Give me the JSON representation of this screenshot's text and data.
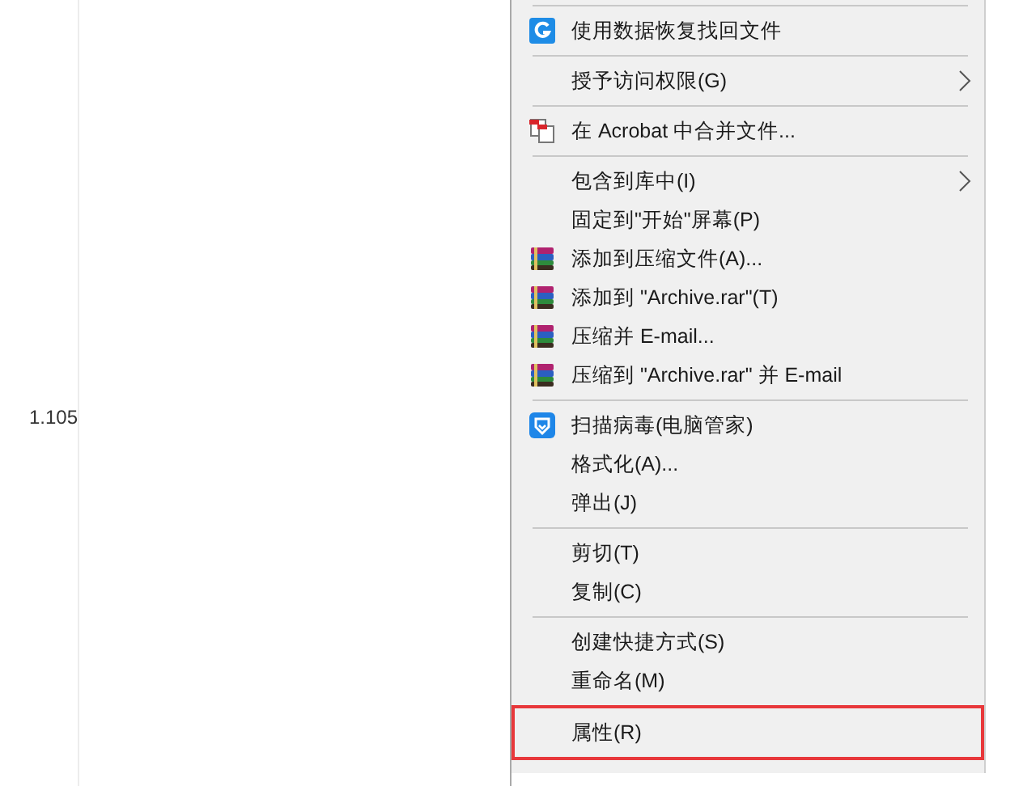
{
  "side_value": "1.105",
  "menu": {
    "groups": [
      [
        {
          "label": "使用数据恢复找回文件",
          "kind": "recovery",
          "submenu": false,
          "outlined": false
        }
      ],
      [
        {
          "label": "授予访问权限(G)",
          "kind": "plain",
          "submenu": true,
          "outlined": false
        }
      ],
      [
        {
          "label": "在 Acrobat 中合并文件...",
          "kind": "acrobat",
          "submenu": false,
          "outlined": false
        }
      ],
      [
        {
          "label": "包含到库中(I)",
          "kind": "plain",
          "submenu": true,
          "outlined": false
        },
        {
          "label": "固定到\"开始\"屏幕(P)",
          "kind": "plain",
          "submenu": false,
          "outlined": false
        },
        {
          "label": "添加到压缩文件(A)...",
          "kind": "archive",
          "submenu": false,
          "outlined": false
        },
        {
          "label": "添加到 \"Archive.rar\"(T)",
          "kind": "archive",
          "submenu": false,
          "outlined": false
        },
        {
          "label": "压缩并 E-mail...",
          "kind": "archive",
          "submenu": false,
          "outlined": false
        },
        {
          "label": "压缩到 \"Archive.rar\" 并 E-mail",
          "kind": "archive",
          "submenu": false,
          "outlined": false
        }
      ],
      [
        {
          "label": "扫描病毒(电脑管家)",
          "kind": "shield",
          "submenu": false,
          "outlined": false
        },
        {
          "label": "格式化(A)...",
          "kind": "plain",
          "submenu": false,
          "outlined": false
        },
        {
          "label": "弹出(J)",
          "kind": "plain",
          "submenu": false,
          "outlined": false
        }
      ],
      [
        {
          "label": "剪切(T)",
          "kind": "plain",
          "submenu": false,
          "outlined": false
        },
        {
          "label": "复制(C)",
          "kind": "plain",
          "submenu": false,
          "outlined": false
        }
      ],
      [
        {
          "label": "创建快捷方式(S)",
          "kind": "plain",
          "submenu": false,
          "outlined": false
        },
        {
          "label": "重命名(M)",
          "kind": "plain",
          "submenu": false,
          "outlined": false
        }
      ],
      [
        {
          "label": "属性(R)",
          "kind": "plain",
          "submenu": false,
          "outlined": true
        }
      ]
    ]
  }
}
